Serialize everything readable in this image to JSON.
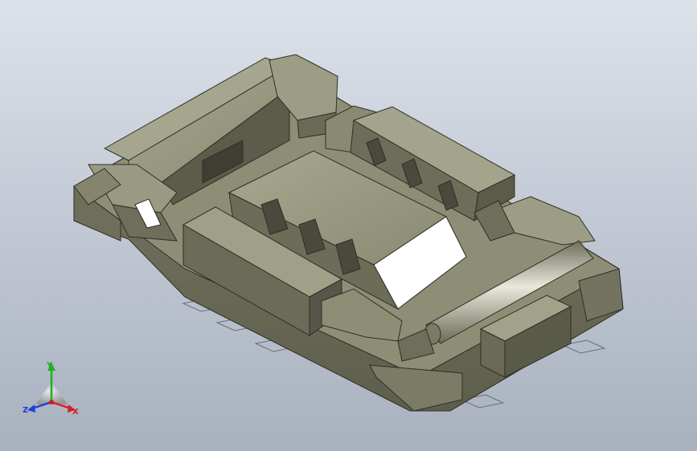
{
  "view": {
    "background_top": "#dde2ea",
    "background_bottom": "#a9b1bf",
    "model_face_color": "#8c8c74",
    "model_dark_color": "#5f5f4e",
    "model_light_color": "#b4b49c"
  },
  "triad": {
    "x_label": "X",
    "y_label": "Y",
    "z_label": "Z",
    "x_color": "#d62020",
    "y_color": "#20b020",
    "z_color": "#2040d0",
    "icon": "view-orientation-triad-icon"
  }
}
